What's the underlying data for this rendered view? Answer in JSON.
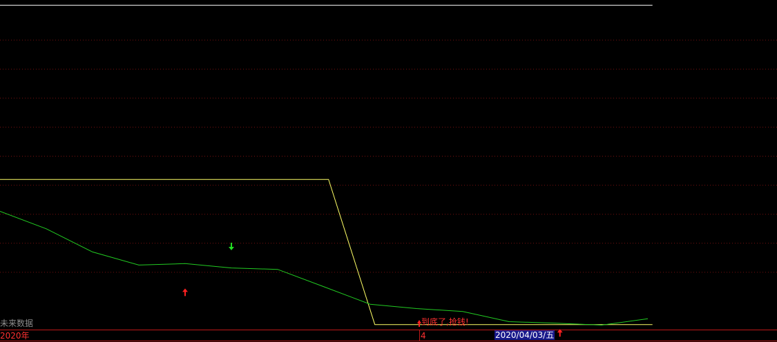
{
  "chart_data": {
    "type": "line",
    "grid": true,
    "colors": {
      "background": "#000000",
      "grid": "#7a1010",
      "axis_line": "#c01818",
      "upper_band": "#ffffff",
      "step_line": "#ffff66",
      "price_line": "#22cc22",
      "buy_arrow": "#ff2020",
      "sell_arrow": "#22dd22"
    },
    "ylim": [
      0,
      100
    ],
    "gridlines": [
      10,
      20,
      30,
      40,
      50,
      60,
      70,
      80,
      90,
      100
    ],
    "upper_band": {
      "x": [
        0,
        1.41
      ],
      "y": [
        102,
        102
      ]
    },
    "step_line": {
      "x": [
        0,
        0.71,
        0.81,
        1.41
      ],
      "y": [
        42,
        42,
        -8,
        -8
      ]
    },
    "price_line": {
      "x": [
        0,
        0.1,
        0.2,
        0.3,
        0.4,
        0.5,
        0.6,
        0.7,
        0.8,
        0.9,
        1.0,
        1.1,
        1.2,
        1.3,
        1.4
      ],
      "y": [
        31,
        25,
        17,
        12.5,
        13,
        11.5,
        11,
        5,
        -1,
        -2.5,
        -3.5,
        -7,
        -7.5,
        -8.2,
        -6
      ]
    },
    "signals": [
      {
        "type": "buy",
        "x": 0.4,
        "y": 3
      },
      {
        "type": "sell",
        "x": 0.5,
        "y": 19
      },
      {
        "type": "buy",
        "x": 1.21,
        "y": -11
      }
    ]
  },
  "labels": {
    "future_data": "未来数据",
    "signal_text": "到底了,抢钱!",
    "year": "2020年",
    "month": "4",
    "date": "2020/04/03/五"
  }
}
